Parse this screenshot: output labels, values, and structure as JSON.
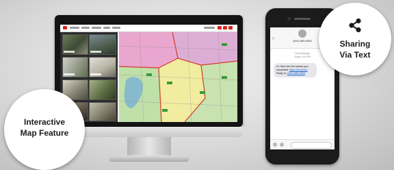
{
  "badges": {
    "map_feature": {
      "line1": "Interactive",
      "line2": "Map Feature"
    },
    "sharing": {
      "line1": "Sharing",
      "line2": "Via Text",
      "icon": "share-icon"
    }
  },
  "colors": {
    "brand_red": "#d7261e",
    "parcel_pink": "#e9a6cf",
    "parcel_green": "#bfe0a8",
    "parcel_yellow": "#f1eca0",
    "boundary": "#d33a2a",
    "link_blue": "#1a5fd0"
  },
  "phone": {
    "back_icon": "chevron-left-icon",
    "contact": "(310) 555-9000",
    "sub1": "Text Message",
    "sub2": "Today 3:53 PM",
    "message_text": "Hi, Here are the homes you requested: ",
    "message_link": "https://bit.ly/3a1",
    "message_tail": " Reply to: ",
    "reply_number": "(310) 555-9000"
  }
}
